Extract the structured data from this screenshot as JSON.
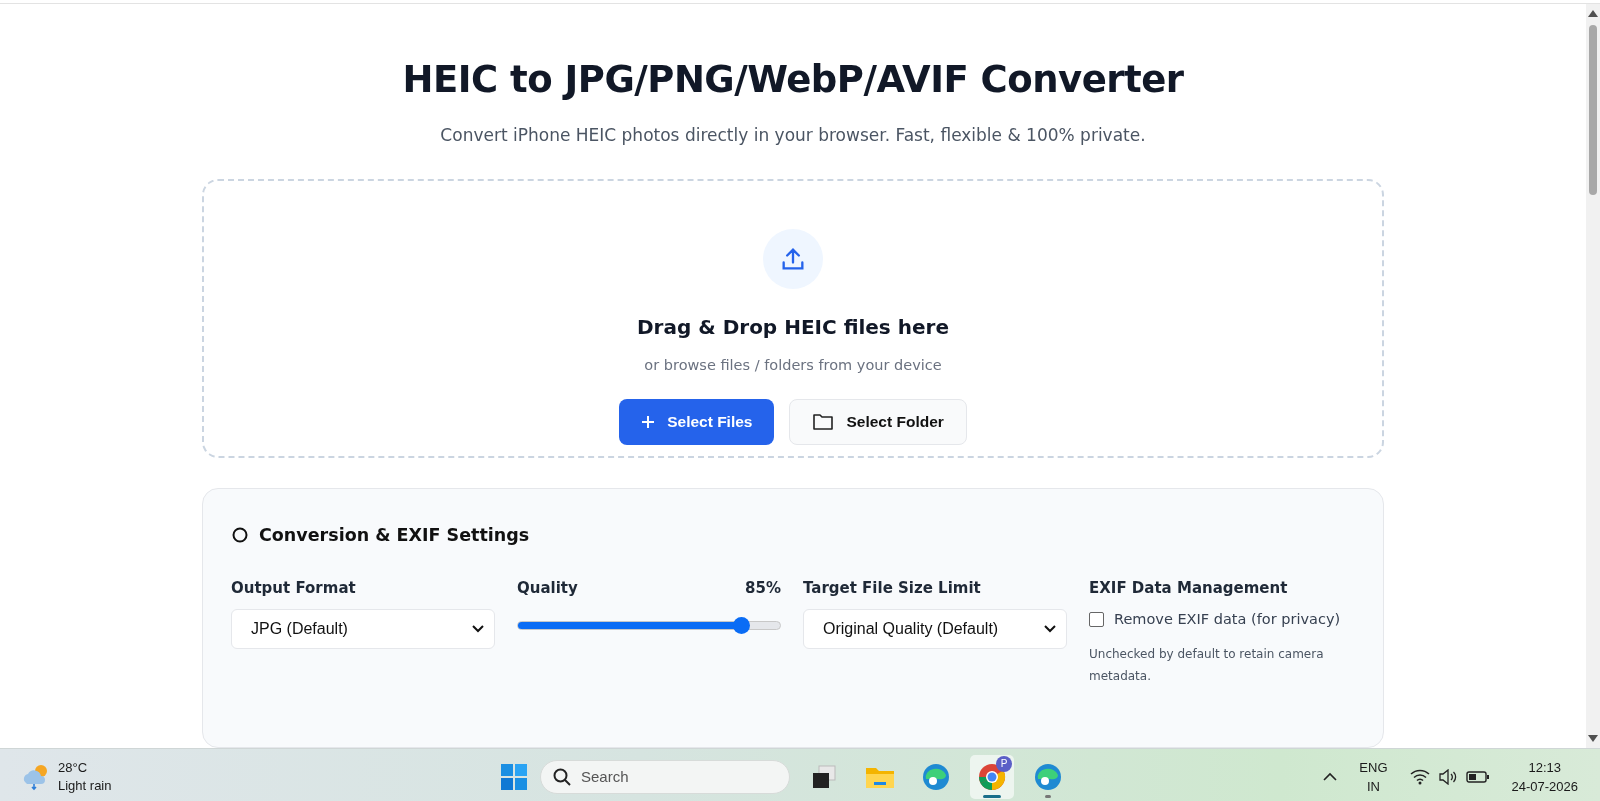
{
  "header": {
    "title": "HEIC to JPG/PNG/WebP/AVIF Converter",
    "subtitle": "Convert iPhone HEIC photos directly in your browser. Fast, flexible & 100% private."
  },
  "dropzone": {
    "heading": "Drag & Drop HEIC files here",
    "hint": "or browse files / folders from your device",
    "buttons": [
      {
        "label": "Select Files",
        "kind": "primary"
      },
      {
        "label": "Select Folder",
        "kind": "secondary"
      }
    ]
  },
  "settings": {
    "title": "Conversion & EXIF Settings",
    "output_format": {
      "label": "Output Format",
      "value": "JPG (Default)"
    },
    "quality": {
      "label": "Quality",
      "reading": "85%",
      "level": 0.85
    },
    "size_limit": {
      "label": "Target File Size Limit",
      "value": "Original Quality (Default)"
    },
    "exif": {
      "label": "EXIF Data Management",
      "option": "Remove EXIF data (for privacy)",
      "checked": false,
      "note": "Unchecked by default to retain camera metadata."
    }
  },
  "taskbar": {
    "weather": {
      "temperature": "28°C",
      "condition": "Light rain"
    },
    "search": {
      "placeholder": "Search"
    },
    "apps": [
      {
        "kind": "taskview",
        "selected": false,
        "running": false
      },
      {
        "kind": "explorer",
        "selected": false,
        "running": false
      },
      {
        "kind": "edge",
        "selected": false,
        "running": false
      },
      {
        "kind": "chrome",
        "badge": "P",
        "selected": true,
        "running": true
      },
      {
        "kind": "edge",
        "selected": false,
        "running": true
      }
    ],
    "language": [
      "ENG",
      "IN"
    ],
    "time": "12:13",
    "date": "24-07-2026"
  }
}
